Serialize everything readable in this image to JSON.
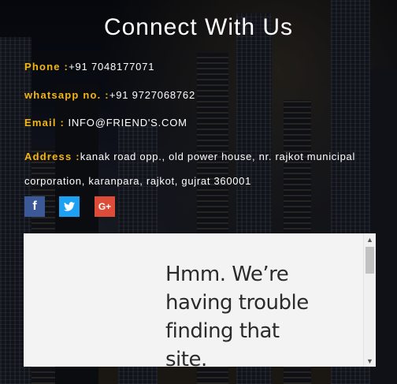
{
  "heading": "Connect With Us",
  "contact": {
    "phone_label": "Phone :",
    "phone_value": "+91 7048177071",
    "whatsapp_label": "whatsapp no. :",
    "whatsapp_value": "+91 9727068762",
    "email_label": "Email :",
    "email_value": " INFO@FRIEND'S.COM",
    "address_label": "Address :",
    "address_value": "kanak road opp., old power house, nr. rajkot municipal corporation, karanpara, rajkot, gujrat 360001"
  },
  "social": {
    "facebook_glyph": "f",
    "twitter_glyph": "🐦",
    "googleplus_glyph": "G+"
  },
  "embed": {
    "error_message": "Hmm. We’re having trouble finding that site."
  },
  "colors": {
    "label_accent": "#f5b512",
    "facebook": "#3b5998",
    "twitter": "#1da1f2",
    "googleplus": "#dd4b39"
  }
}
